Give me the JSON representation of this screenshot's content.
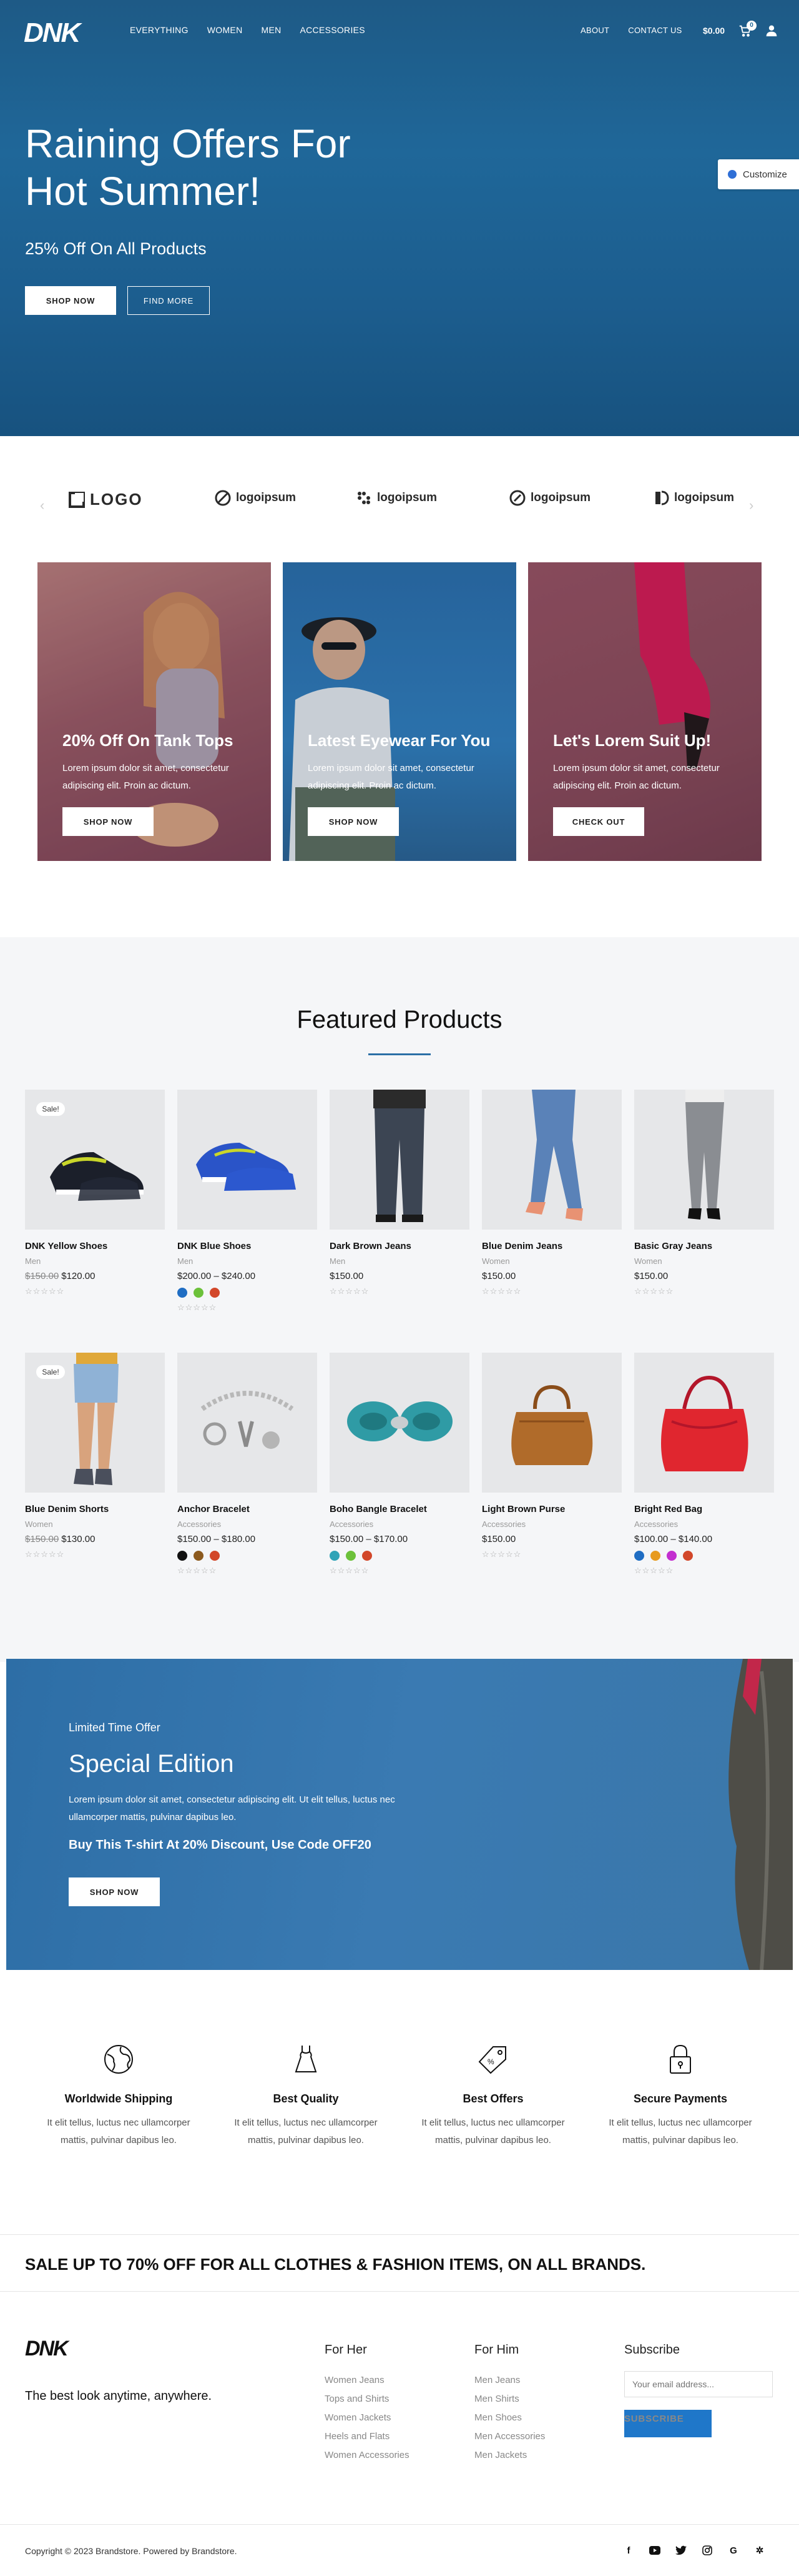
{
  "brand": "DNK",
  "nav": {
    "left": [
      "EVERYTHING",
      "WOMEN",
      "MEN",
      "ACCESSORIES"
    ],
    "right": [
      "ABOUT",
      "CONTACT US"
    ],
    "cart_amount": "$0.00",
    "cart_count": "0"
  },
  "hero": {
    "title": "Raining Offers For Hot Summer!",
    "subtitle": "25% Off On All Products",
    "primary_btn": "SHOP NOW",
    "secondary_btn": "FIND MORE"
  },
  "customize_label": "Customize",
  "partner_logos": [
    "LOGO",
    "logoipsum",
    "logoipsum",
    "logoipsum",
    "logoipsum"
  ],
  "promos": [
    {
      "title": "20% Off On Tank Tops",
      "text": "Lorem ipsum dolor sit amet, consectetur adipiscing elit. Proin ac dictum.",
      "btn": "SHOP NOW"
    },
    {
      "title": "Latest Eyewear For You",
      "text": "Lorem ipsum dolor sit amet, consectetur adipiscing elit. Proin ac dictum.",
      "btn": "SHOP NOW"
    },
    {
      "title": "Let's Lorem Suit Up!",
      "text": "Lorem ipsum dolor sit amet, consectetur adipiscing elit. Proin ac dictum.",
      "btn": "CHECK OUT"
    }
  ],
  "featured": {
    "title": "Featured Products",
    "sale_badge": "Sale!",
    "products": [
      {
        "name": "DNK Yellow Shoes",
        "category": "Men",
        "old_price": "$150.00",
        "price": "$120.00"
      },
      {
        "name": "DNK Blue Shoes",
        "category": "Men",
        "price": "$200.00 – $240.00"
      },
      {
        "name": "Dark Brown Jeans",
        "category": "Men",
        "price": "$150.00"
      },
      {
        "name": "Blue Denim Jeans",
        "category": "Women",
        "price": "$150.00"
      },
      {
        "name": "Basic Gray Jeans",
        "category": "Women",
        "price": "$150.00"
      },
      {
        "name": "Blue Denim Shorts",
        "category": "Women",
        "old_price": "$150.00",
        "price": "$130.00"
      },
      {
        "name": "Anchor Bracelet",
        "category": "Accessories",
        "price": "$150.00 – $180.00"
      },
      {
        "name": "Boho Bangle Bracelet",
        "category": "Accessories",
        "price": "$150.00 – $170.00"
      },
      {
        "name": "Light Brown Purse",
        "category": "Accessories",
        "price": "$150.00"
      },
      {
        "name": "Bright Red Bag",
        "category": "Accessories",
        "price": "$100.00 – $140.00"
      }
    ]
  },
  "special": {
    "kicker": "Limited Time Offer",
    "title": "Special Edition",
    "text": "Lorem ipsum dolor sit amet, consectetur adipiscing elit. Ut elit tellus, luctus nec ullamcorper mattis, pulvinar dapibus leo.",
    "code_line": "Buy This T-shirt At 20% Discount, Use Code OFF20",
    "btn": "SHOP NOW"
  },
  "features": [
    {
      "title": "Worldwide Shipping",
      "text": "It elit tellus, luctus nec ullamcorper mattis, pulvinar dapibus leo."
    },
    {
      "title": "Best Quality",
      "text": "It elit tellus, luctus nec ullamcorper mattis, pulvinar dapibus leo."
    },
    {
      "title": "Best Offers",
      "text": "It elit tellus, luctus nec ullamcorper mattis, pulvinar dapibus leo."
    },
    {
      "title": "Secure Payments",
      "text": "It elit tellus, luctus nec ullamcorper mattis, pulvinar dapibus leo."
    }
  ],
  "sale_banner": "SALE UP TO 70% OFF FOR ALL CLOTHES & FASHION ITEMS, ON ALL BRANDS.",
  "footer": {
    "tagline": "The best look anytime, anywhere.",
    "her_title": "For Her",
    "her_links": [
      "Women Jeans",
      "Tops and Shirts",
      "Women Jackets",
      "Heels and Flats",
      "Women Accessories"
    ],
    "him_title": "For Him",
    "him_links": [
      "Men Jeans",
      "Men Shirts",
      "Men Shoes",
      "Men Accessories",
      "Men Jackets"
    ],
    "subscribe_title": "Subscribe",
    "email_placeholder": "Your email address...",
    "subscribe_btn": "SUBSCRIBE",
    "copyright": "Copyright © 2023 Brandstore. Powered by Brandstore.",
    "social_icons": [
      "facebook-icon",
      "youtube-icon",
      "twitter-icon",
      "instagram-icon",
      "google-icon",
      "yelp-icon"
    ]
  }
}
